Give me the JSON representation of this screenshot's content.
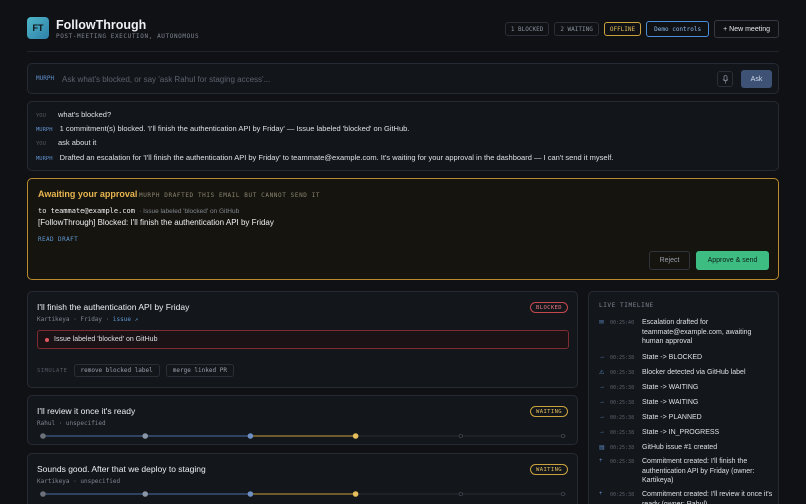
{
  "header": {
    "logo": "FT",
    "brand": "FollowThrough",
    "tagline": "POST-MEETING EXECUTION, AUTONOMOUS",
    "blocked": "1 BLOCKED",
    "waiting": "2 WAITING",
    "offline": "OFFLINE",
    "demo": "Demo controls",
    "new_meeting": "+ New meeting"
  },
  "ask": {
    "who": "MURPH",
    "placeholder": "Ask what's blocked, or say 'ask Rahul for staging access'...",
    "button": "Ask"
  },
  "chat": [
    {
      "who": "YOU",
      "text": "what's blocked?"
    },
    {
      "who": "MURPH",
      "text": "1 commitment(s) blocked. 'I'll finish the authentication API by Friday' — Issue labeled 'blocked' on GitHub."
    },
    {
      "who": "YOU",
      "text": "ask about it"
    },
    {
      "who": "MURPH",
      "text": "Drafted an escalation for 'I'll finish the authentication API by Friday' to teammate@example.com. It's waiting for your approval in the dashboard — I can't send it myself."
    }
  ],
  "approval": {
    "title": "Awaiting your approval",
    "subtitle": "MURPH DRAFTED THIS EMAIL BUT CANNOT SEND IT",
    "to_label": "to",
    "to_addr": "teammate@example.com",
    "to_note": "· Issue labeled 'blocked' on GitHub",
    "subject": "[FollowThrough] Blocked: I'll finish the authentication API by Friday",
    "read": "READ DRAFT",
    "reject": "Reject",
    "approve": "Approve & send"
  },
  "cards": [
    {
      "title": "I'll finish the authentication API by Friday",
      "owner": "Kartikeya",
      "due": "Friday",
      "link": "issue ↗",
      "badge": "BLOCKED",
      "blocker": "Issue labeled 'blocked' on GitHub",
      "simulate": "SIMULATE",
      "sim1": "remove blocked label",
      "sim2": "merge linked PR"
    },
    {
      "title": "I'll review it once it's ready",
      "owner": "Rahul",
      "due": "unspecified",
      "badge": "WAITING",
      "progress_stage": 4
    },
    {
      "title": "Sounds good. After that we deploy to staging",
      "owner": "Kartikeya",
      "due": "unspecified",
      "badge": "WAITING",
      "progress_stage": 4
    }
  ],
  "timeline": {
    "title": "LIVE TIMELINE",
    "events": [
      {
        "icon": "mail-icon",
        "glyph": "✉",
        "ts": "00:25:40",
        "text": "Escalation drafted for teammate@example.com, awaiting human approval"
      },
      {
        "icon": "arrow-icon",
        "glyph": "→",
        "ts": "00:25:38",
        "text": "State -> BLOCKED"
      },
      {
        "icon": "warning-icon",
        "glyph": "⚠",
        "ts": "00:25:38",
        "text": "Blocker detected via GitHub label"
      },
      {
        "icon": "arrow-icon",
        "glyph": "→",
        "ts": "00:25:38",
        "text": "State -> WAITING"
      },
      {
        "icon": "arrow-icon",
        "glyph": "→",
        "ts": "00:25:38",
        "text": "State -> WAITING"
      },
      {
        "icon": "arrow-icon",
        "glyph": "→",
        "ts": "00:25:38",
        "text": "State -> PLANNED"
      },
      {
        "icon": "arrow-icon",
        "glyph": "→",
        "ts": "00:25:38",
        "text": "State -> IN_PROGRESS"
      },
      {
        "icon": "document-icon",
        "glyph": "▤",
        "ts": "00:25:38",
        "text": "GitHub issue #1 created"
      },
      {
        "icon": "plus-icon",
        "glyph": "+",
        "ts": "00:25:38",
        "text": "Commitment created: I'll finish the authentication API by Friday (owner: Kartikeya)"
      },
      {
        "icon": "plus-icon",
        "glyph": "+",
        "ts": "00:25:38",
        "text": "Commitment created: I'll review it once it's ready (owner: Rahul)"
      }
    ]
  },
  "colors": {
    "accent": "#e8b550",
    "approve": "#3ebd83",
    "blocked": "#e05960",
    "link": "#5f9ad6"
  }
}
